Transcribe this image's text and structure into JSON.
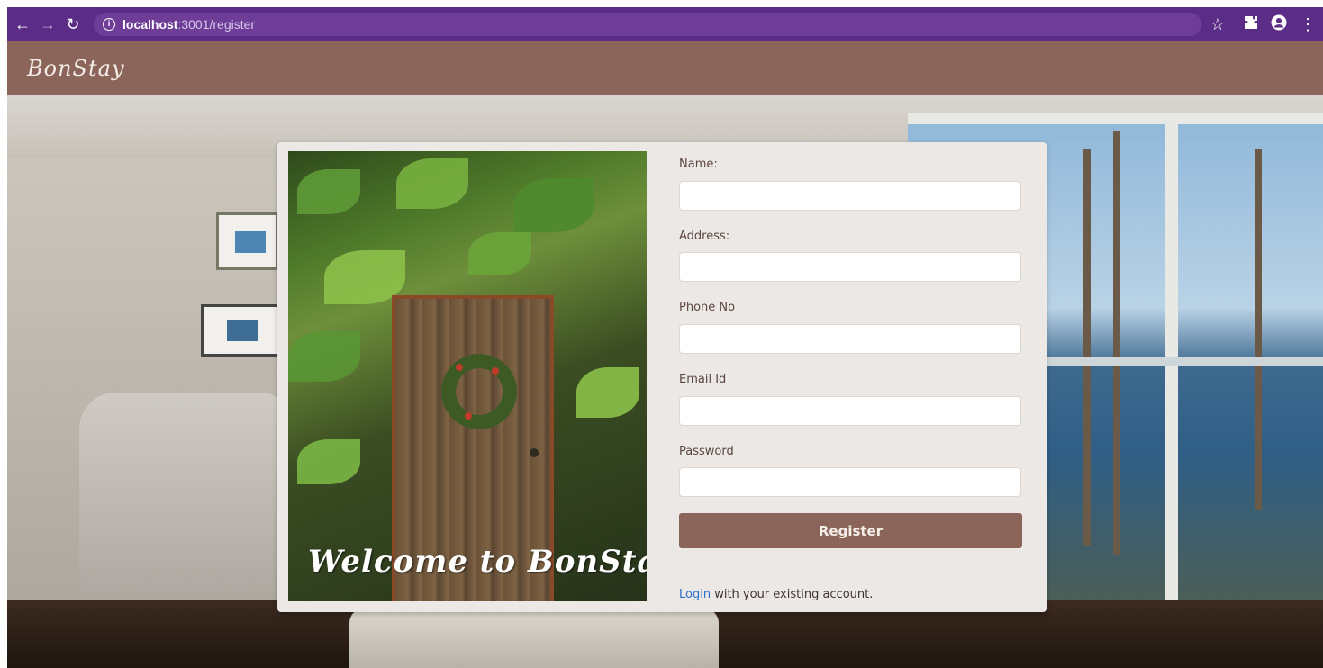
{
  "browser": {
    "back_icon": "arrow-left-icon",
    "forward_icon": "arrow-right-icon",
    "reload_icon": "reload-icon",
    "url_host": "localhost",
    "url_path": ":3001/register",
    "toolbar_icons": [
      "star-icon",
      "extension-icon",
      "profile-icon",
      "menu-icon"
    ]
  },
  "header": {
    "brand": "BonStay",
    "bar_color": "#8c655a"
  },
  "card": {
    "welcome_text": "Welcome to BonStay",
    "fields": [
      {
        "label": "Name:",
        "value": "",
        "placeholder": ""
      },
      {
        "label": "Address:",
        "value": "",
        "placeholder": ""
      },
      {
        "label": "Phone No",
        "value": "",
        "placeholder": ""
      },
      {
        "label": "Email Id",
        "value": "",
        "placeholder": ""
      },
      {
        "label": "Password",
        "value": "",
        "placeholder": ""
      }
    ],
    "register_label": "Register",
    "login_link": "Login",
    "login_suffix": " with your existing account."
  },
  "colors": {
    "browser_bar": "#5b2d86",
    "accent": "#8c655a",
    "link": "#2a6fc9",
    "card_bg": "#ece8e5"
  }
}
